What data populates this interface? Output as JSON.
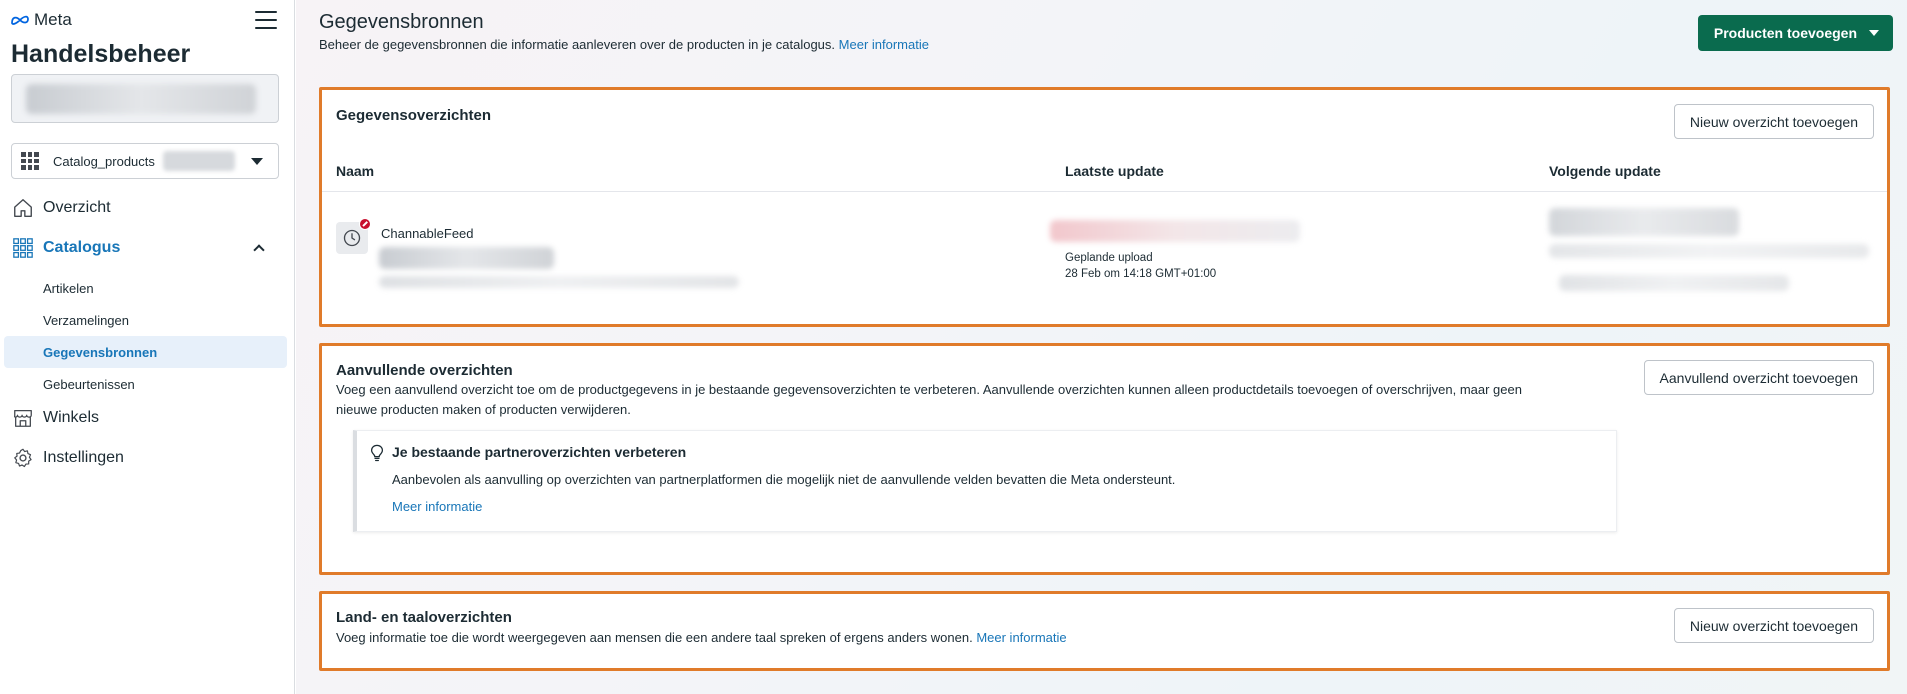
{
  "sidebar": {
    "brand": "Meta",
    "app_title": "Handelsbeheer",
    "catalog_selector": {
      "value": "Catalog_products"
    },
    "nav": {
      "overview": "Overzicht",
      "catalog": "Catalogus",
      "catalog_sub": [
        "Artikelen",
        "Verzamelingen",
        "Gegevensbronnen",
        "Gebeurtenissen"
      ],
      "shops": "Winkels",
      "settings": "Instellingen"
    }
  },
  "header": {
    "title": "Gegevensbronnen",
    "subtitle": "Beheer de gegevensbronnen die informatie aanleveren over de producten in je catalogus.",
    "subtitle_link": "Meer informatie",
    "primary_button": "Producten toevoegen"
  },
  "data_feeds": {
    "title": "Gegevensoverzichten",
    "add_button": "Nieuw overzicht toevoegen",
    "columns": [
      "Naam",
      "Laatste update",
      "Volgende update"
    ],
    "rows": [
      {
        "name": "ChannableFeed",
        "last_update_label": "Geplande upload",
        "last_update_time": "28 Feb om 14:18 GMT+01:00"
      }
    ]
  },
  "supplementary": {
    "title": "Aanvullende overzichten",
    "add_button": "Aanvullend overzicht toevoegen",
    "description_line1": "Voeg een aanvullend overzicht toe om de productgegevens in je bestaande gegevensoverzichten te verbeteren. Aanvullende overzichten kunnen alleen productdetails toevoegen of overschrijven, maar geen",
    "description_line2": "nieuwe producten maken of producten verwijderen.",
    "tip": {
      "title": "Je bestaande partneroverzichten verbeteren",
      "text": "Aanbevolen als aanvulling op overzichten van partnerplatformen die mogelijk niet de aanvullende velden bevatten die Meta ondersteunt.",
      "link": "Meer informatie"
    }
  },
  "localized": {
    "title": "Land- en taaloverzichten",
    "description": "Voeg informatie toe die wordt weergegeven aan mensen die een andere taal spreken of ergens anders wonen.",
    "link": "Meer informatie",
    "add_button": "Nieuw overzicht toevoegen"
  },
  "colors": {
    "primary_green": "#0a6b4e",
    "highlight_orange": "#e07b2a",
    "link_blue": "#1876b8",
    "error_red": "#c8102e"
  }
}
